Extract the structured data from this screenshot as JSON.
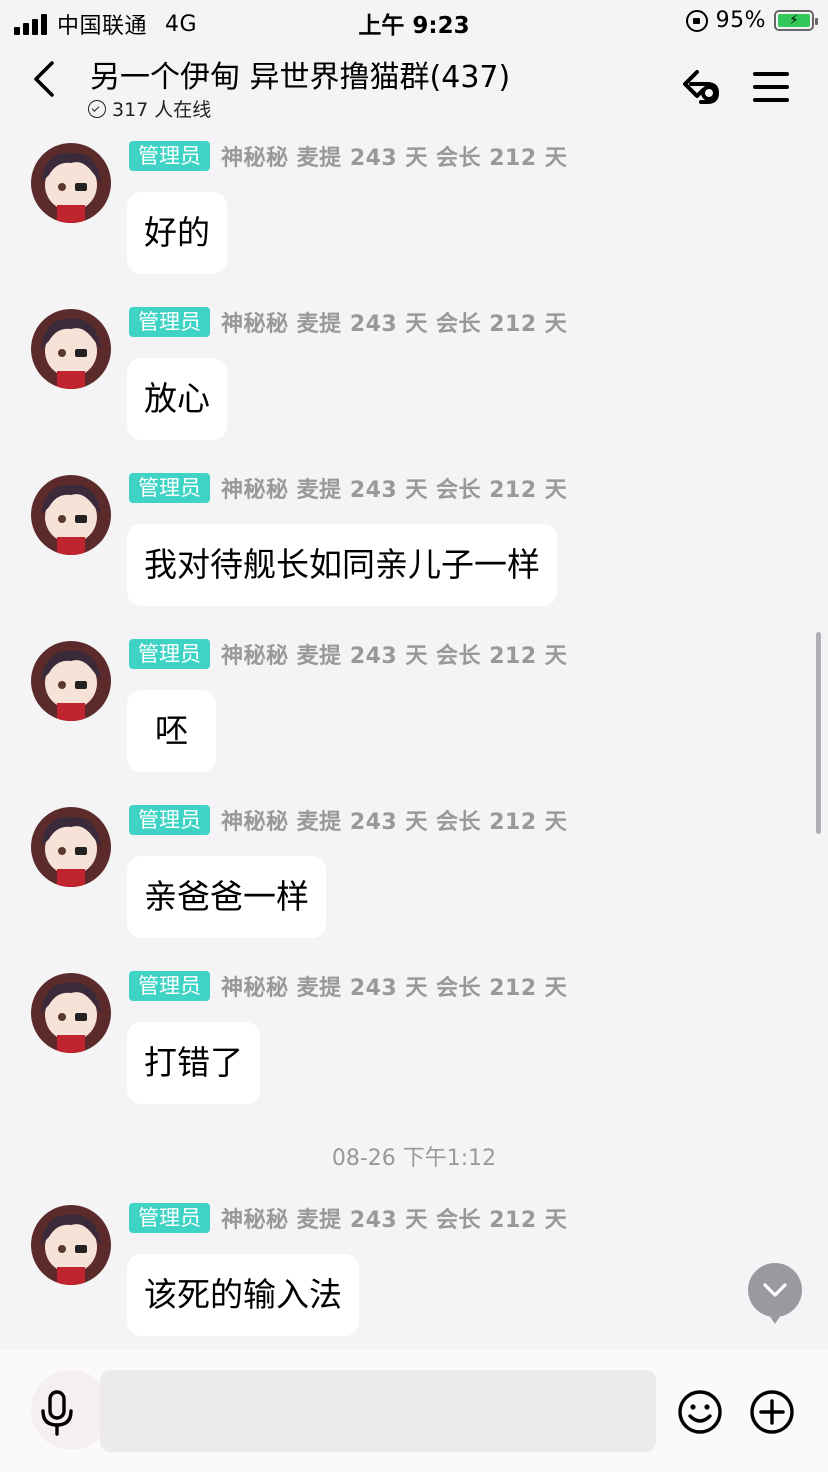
{
  "status_bar": {
    "carrier": "中国联通",
    "network": "4G",
    "time": "上午 9:23",
    "battery": "95%"
  },
  "header": {
    "title": "另一个伊甸 异世界撸猫群(437)",
    "online": "317 人在线",
    "icons": [
      "back-icon",
      "share-link-icon",
      "menu-icon"
    ]
  },
  "messages": [
    {
      "badge": "管理员",
      "sender": "神秘秘 麦提 243 天 会长 212 天",
      "text": "好的"
    },
    {
      "badge": "管理员",
      "sender": "神秘秘 麦提 243 天 会长 212 天",
      "text": "放心"
    },
    {
      "badge": "管理员",
      "sender": "神秘秘 麦提 243 天 会长 212 天",
      "text": "我对待舰长如同亲儿子一样"
    },
    {
      "badge": "管理员",
      "sender": "神秘秘 麦提 243 天 会长 212 天",
      "text": "呸"
    },
    {
      "badge": "管理员",
      "sender": "神秘秘 麦提 243 天 会长 212 天",
      "text": "亲爸爸一样"
    },
    {
      "badge": "管理员",
      "sender": "神秘秘 麦提 243 天 会长 212 天",
      "text": "打错了"
    },
    {
      "badge": "管理员",
      "sender": "神秘秘 麦提 243 天 会长 212 天",
      "text": "该死的输入法"
    }
  ],
  "timestamp": "08-26 下午1:12",
  "input": {
    "placeholder": "",
    "value": ""
  },
  "colors": {
    "badge": "#3ed3c5",
    "background": "#f4f4f6",
    "battery": "#34c759"
  }
}
